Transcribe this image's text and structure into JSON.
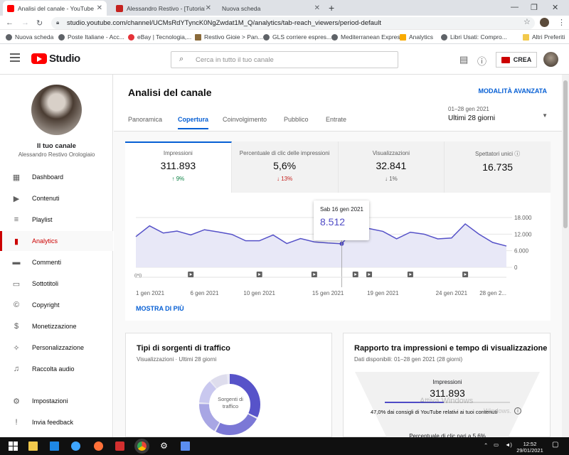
{
  "browser": {
    "tabs": [
      {
        "title": "Analisi del canale - YouTube Stud",
        "active": true
      },
      {
        "title": "Alessandro Restivo - [Tutorial e R",
        "active": false
      },
      {
        "title": "Nuova scheda",
        "active": false
      }
    ],
    "url": "studio.youtube.com/channel/UCMsRdYTyncK0NgZwdat1M_Q/analytics/tab-reach_viewers/period-default",
    "bookmarks": [
      "Nuova scheda",
      "Poste Italiane - Acc...",
      "eBay | Tecnologia,...",
      "Restivo Gioie > Pan...",
      "GLS corriere espres...",
      "Mediterranean Express",
      "Analytics",
      "Libri Usati: Compro...",
      "Altri Preferiti"
    ]
  },
  "header": {
    "logo_text": "Studio",
    "search_placeholder": "Cerca in tutto il tuo canale",
    "create_label": "CREA"
  },
  "sidebar": {
    "channel_title": "Il tuo canale",
    "channel_name": "Alessandro Restivo Orologiaio",
    "items": [
      {
        "label": "Dashboard",
        "icon": "dashboard-icon"
      },
      {
        "label": "Contenuti",
        "icon": "content-icon"
      },
      {
        "label": "Playlist",
        "icon": "playlist-icon"
      },
      {
        "label": "Analytics",
        "icon": "analytics-icon",
        "active": true
      },
      {
        "label": "Commenti",
        "icon": "comments-icon"
      },
      {
        "label": "Sottotitoli",
        "icon": "subtitles-icon"
      },
      {
        "label": "Copyright",
        "icon": "copyright-icon"
      },
      {
        "label": "Monetizzazione",
        "icon": "dollar-icon"
      },
      {
        "label": "Personalizzazione",
        "icon": "wand-icon"
      },
      {
        "label": "Raccolta audio",
        "icon": "audio-library-icon"
      },
      {
        "label": "Impostazioni",
        "icon": "gear-icon"
      },
      {
        "label": "Invia feedback",
        "icon": "feedback-icon"
      }
    ]
  },
  "main": {
    "title": "Analisi del canale",
    "advanced_mode": "MODALITÀ AVANZATA",
    "tabs": [
      "Panoramica",
      "Copertura",
      "Coinvolgimento",
      "Pubblico",
      "Entrate"
    ],
    "active_tab": "Copertura",
    "period_range": "01–28 gen 2021",
    "period_label": "Ultimi 28 giorni",
    "metrics": [
      {
        "label": "Impressioni",
        "value": "311.893",
        "delta": "9%",
        "direction": "up",
        "active": true
      },
      {
        "label": "Percentuale di clic delle impressioni",
        "value": "5,6%",
        "delta": "13%",
        "direction": "down",
        "active": false
      },
      {
        "label": "Visualizzazioni",
        "value": "32.841",
        "delta": "1%",
        "direction": "neutral",
        "active": false
      },
      {
        "label": "Spettatori unici",
        "value": "16.735",
        "delta": "",
        "direction": "none",
        "active": false
      }
    ],
    "tooltip": {
      "date": "Sab 16 gen 2021",
      "value": "8.512"
    },
    "show_more": "MOSTRA DI PIÙ",
    "traffic_card": {
      "title": "Tipi di sorgenti di traffico",
      "subtitle": "Visualizzazioni · Ultimi 28 giorni",
      "donut_label": "Sorgenti di traffico"
    },
    "ratio_card": {
      "title": "Rapporto tra impressioni e tempo di visualizzazione",
      "subtitle": "Dati disponibili: 01–28 gen 2021 (28 giorni)",
      "impressions_label": "Impressioni",
      "impressions_value": "311.893",
      "suggested_share": 0.47,
      "note": "47,0% dai consigli di YouTube relativi ai tuoi contenuti",
      "ctr_label": "Percentuale di clic pari a 5,6%"
    }
  },
  "watermark": {
    "line1": "Attiva Windows",
    "line2": "Windows."
  },
  "taskbar": {
    "time": "12:52",
    "date": "29/01/2021"
  },
  "chart_data": {
    "type": "area",
    "x": [
      "1 gen 2021",
      "2 gen",
      "3 gen",
      "4 gen",
      "5 gen",
      "6 gen 2021",
      "7 gen",
      "8 gen",
      "9 gen",
      "10 gen 2021",
      "11 gen",
      "12 gen",
      "13 gen",
      "14 gen",
      "15 gen 2021",
      "16 gen",
      "17 gen",
      "18 gen",
      "19 gen 2021",
      "20 gen",
      "21 gen",
      "22 gen",
      "23 gen",
      "24 gen 2021",
      "25 gen",
      "26 gen",
      "27 gen",
      "28 gen"
    ],
    "x_tick_labels": [
      "1 gen 2021",
      "6 gen 2021",
      "10 gen 2021",
      "15 gen 2021",
      "19 gen 2021",
      "24 gen 2021",
      "28 gen 2..."
    ],
    "y_tick_labels": [
      "18.000",
      "12.000",
      "6.000",
      "0"
    ],
    "ylim": [
      0,
      18000
    ],
    "series": [
      {
        "values": [
          11100,
          15000,
          12400,
          13100,
          11700,
          13600,
          12800,
          11900,
          9600,
          9600,
          11700,
          8600,
          10400,
          9200,
          8800,
          8512,
          14200,
          14000,
          13000,
          10300,
          12700,
          12000,
          10300,
          10600,
          15700,
          12000,
          9000,
          7700
        ]
      }
    ],
    "highlight_index": 15,
    "grid": true
  }
}
